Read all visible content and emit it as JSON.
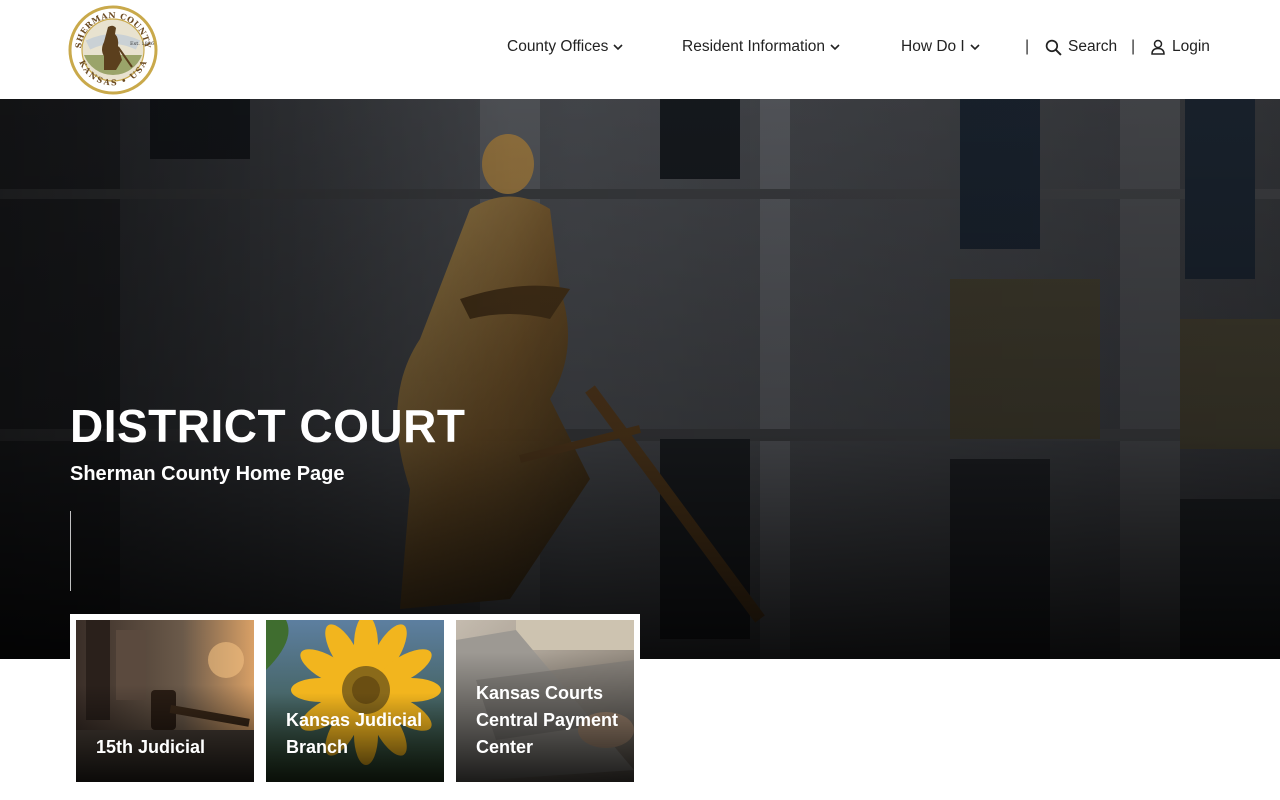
{
  "header": {
    "logo": {
      "arc_top": "SHERMAN COUNTY",
      "arc_bottom": "KANSAS • USA",
      "est": "Est. 1886",
      "icon": "county-seal"
    },
    "nav": [
      {
        "label": "County Offices",
        "icon": "chevron-down-icon"
      },
      {
        "label": "Resident Information",
        "icon": "chevron-down-icon"
      },
      {
        "label": "How Do I",
        "icon": "chevron-down-icon"
      }
    ],
    "separator": "|",
    "search_label": "Search",
    "login_label": "Login"
  },
  "hero": {
    "title": "DISTRICT COURT",
    "subtitle": "Sherman County Home Page"
  },
  "cards": [
    {
      "label": "15th Judicial",
      "image": "gavel-photo"
    },
    {
      "label": "Kansas Judicial Branch",
      "image": "sunflower-photo"
    },
    {
      "label": "Kansas Courts Central Payment Center",
      "image": "laptop-photo"
    }
  ],
  "colors": {
    "text": "#222222",
    "seal_gold": "#c9a94b",
    "seal_brown": "#6b4a22",
    "hero_overlay": "#1c1d20"
  }
}
